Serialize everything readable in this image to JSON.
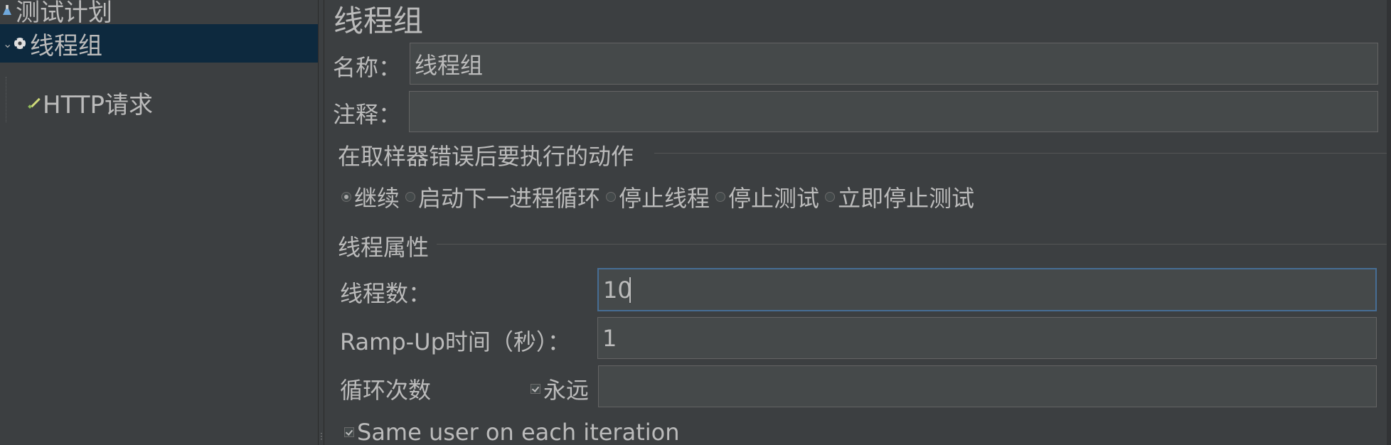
{
  "tree": {
    "items": [
      {
        "label": "测试计划",
        "icon": "flask-icon"
      },
      {
        "label": "线程组",
        "icon": "gear-icon",
        "expanded": true,
        "selected": true
      },
      {
        "label": "HTTP请求",
        "icon": "pen-icon"
      }
    ]
  },
  "panel": {
    "title": "线程组",
    "name_label": "名称：",
    "name_value": "线程组",
    "comment_label": "注释：",
    "comment_value": "",
    "error_group": {
      "title": "在取样器错误后要执行的动作",
      "options": [
        {
          "label": "继续",
          "selected": true
        },
        {
          "label": "启动下一进程循环",
          "selected": false
        },
        {
          "label": "停止线程",
          "selected": false
        },
        {
          "label": "停止测试",
          "selected": false
        },
        {
          "label": "立即停止测试",
          "selected": false
        }
      ]
    },
    "thread_group": {
      "title": "线程属性",
      "threads_label": "线程数：",
      "threads_value": "10",
      "rampup_label": "Ramp-Up时间（秒）：",
      "rampup_value": "1",
      "loop_label": "循环次数",
      "forever_label": "永远",
      "forever_checked": true,
      "loop_value": "",
      "same_user_label": "Same user on each iteration",
      "same_user_checked": true
    }
  },
  "colors": {
    "background": "#3c3f41",
    "selection": "#0d293e",
    "input_bg": "#45494a",
    "focus_border": "#466d94",
    "text": "#bbbbbb"
  }
}
